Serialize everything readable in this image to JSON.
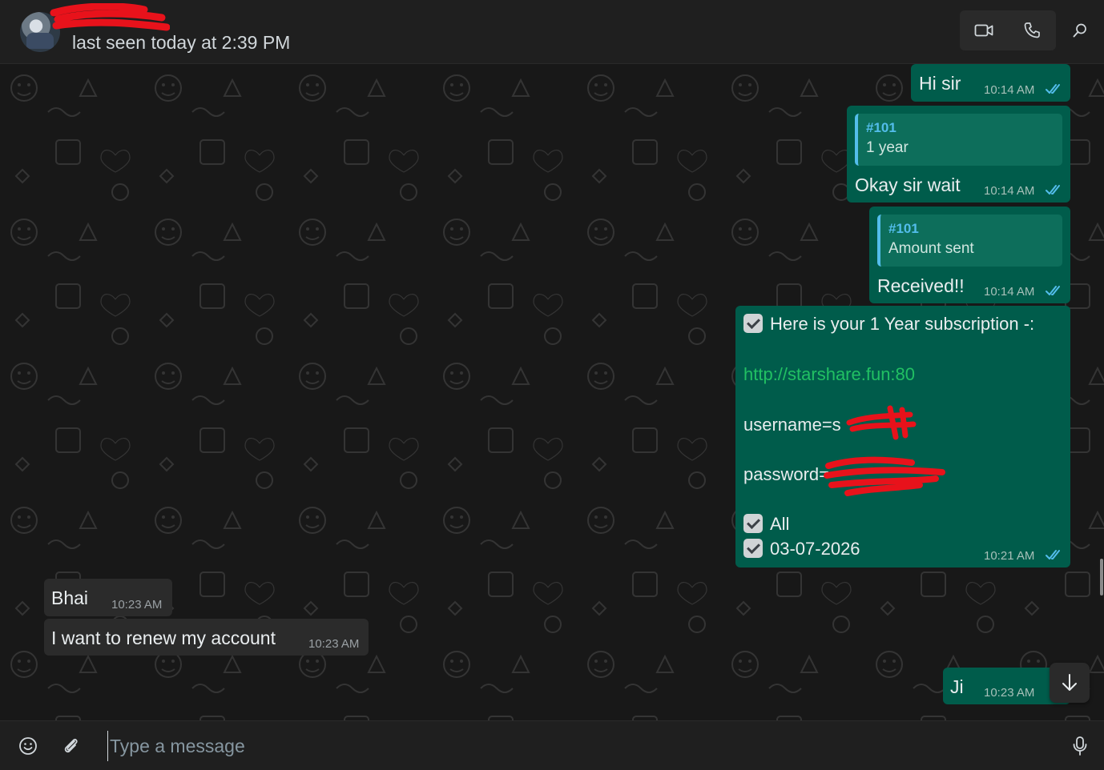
{
  "header": {
    "status": "last seen today at 2:39 PM",
    "icons": [
      "avatar",
      "video-call-icon",
      "voice-call-icon",
      "search-icon"
    ]
  },
  "messages": {
    "m1": {
      "text": "Hi sir",
      "time": "10:14 AM"
    },
    "m2": {
      "quote_author": "#101",
      "quote_text": "1 year",
      "text": "Okay sir wait",
      "time": "10:14 AM"
    },
    "m3": {
      "quote_author": "#101",
      "quote_text": "Amount sent",
      "text": "Received!!",
      "time": "10:14 AM"
    },
    "m4": {
      "line1": "Here is your 1 Year subscription -:",
      "link": "http://starshare.fun:80",
      "username": "username=s",
      "password": "password=",
      "line5": "All",
      "line6": "03-07-2026",
      "time": "10:21 AM"
    },
    "m5": {
      "text": "Bhai",
      "time": "10:23 AM"
    },
    "m6": {
      "text": "I want to renew my account",
      "time": "10:23 AM"
    },
    "m7": {
      "text": "Ji",
      "time": "10:23 AM"
    }
  },
  "composer": {
    "placeholder": "Type a message",
    "icons": [
      "emoji-icon",
      "attach-icon",
      "mic-icon"
    ]
  },
  "colors": {
    "outgoing_bubble": "#005c4b",
    "incoming_bubble": "#2b2b2b",
    "read_ticks": "#53bdeb",
    "link": "#21c063",
    "redaction": "#e8121b"
  }
}
